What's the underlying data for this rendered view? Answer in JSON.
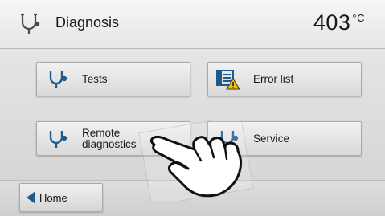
{
  "header": {
    "title": "Diagnosis",
    "temperature": "403",
    "unit": "°C",
    "icon": "stethoscope-icon"
  },
  "buttons": {
    "tests": {
      "label": "Tests",
      "icon": "stethoscope-icon"
    },
    "error_list": {
      "label": "Error list",
      "icon": "error-list-icon"
    },
    "remote": {
      "label_line1": "Remote",
      "label_line2": "diagnostics",
      "icon": "stethoscope-icon"
    },
    "service": {
      "label": "Service",
      "icon": "stethoscope-icon"
    }
  },
  "footer": {
    "home_label": "Home",
    "home_icon": "back-arrow-icon"
  },
  "colors": {
    "icon_blue": "#1e5b8c",
    "warning_yellow": "#f2c200"
  }
}
